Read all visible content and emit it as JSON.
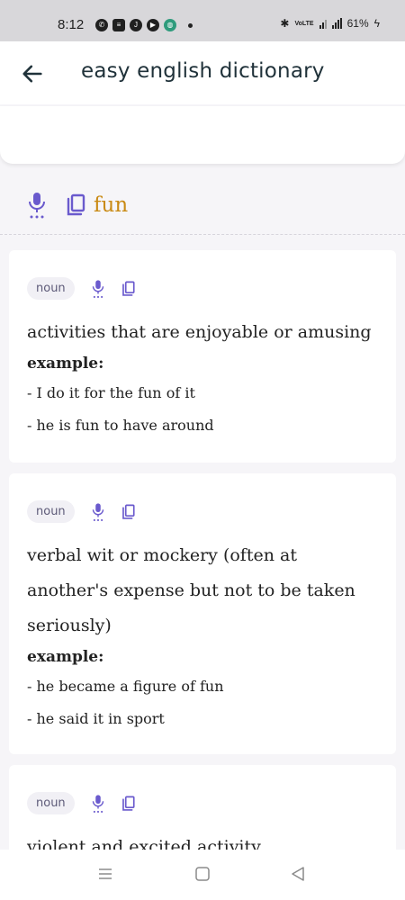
{
  "status_bar": {
    "time": "8:12",
    "battery": "61%",
    "network_badge": "VoLTE"
  },
  "header": {
    "title": "easy english dictionary",
    "back_icon": "arrow-left-icon"
  },
  "search": {
    "value": ""
  },
  "word": {
    "text": "fun",
    "color": "#c98a14"
  },
  "colors": {
    "accent": "#6a5acd",
    "word": "#c98a14",
    "badge_bg": "#f1f0f5"
  },
  "example_label": "example:",
  "entries": [
    {
      "part_of_speech": "noun",
      "definition": "activities that are enjoyable or amusing",
      "examples": [
        "- I do it for the fun of it",
        "- he is fun to have around"
      ]
    },
    {
      "part_of_speech": "noun",
      "definition": "verbal wit or mockery (often at another's expense but not to be taken seriously)",
      "examples": [
        "- he became a figure of fun",
        "- he said it in sport"
      ]
    },
    {
      "part_of_speech": "noun",
      "definition": "violent and excited activity",
      "examples": []
    }
  ]
}
